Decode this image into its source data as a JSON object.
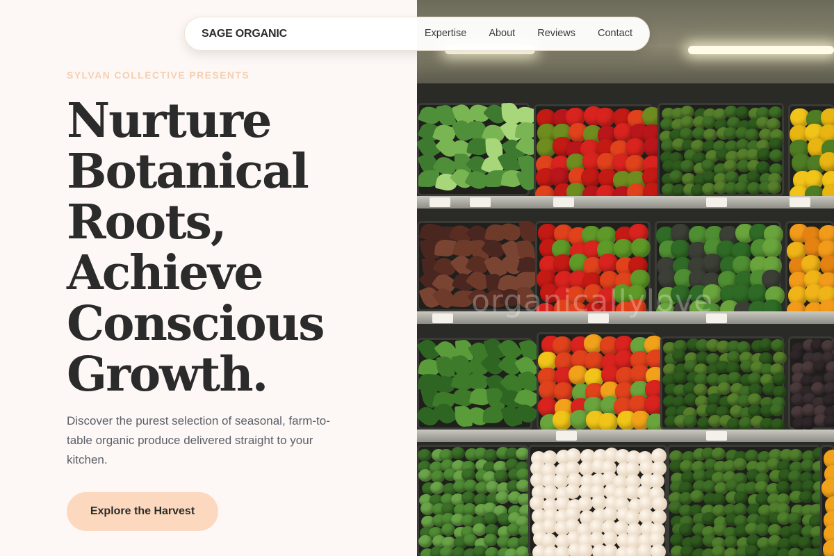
{
  "nav": {
    "brand": "SAGE ORGANIC",
    "links": [
      "Expertise",
      "About",
      "Reviews",
      "Contact"
    ]
  },
  "hero": {
    "eyebrow": "SYLVAN COLLECTIVE PRESENTS",
    "headline_lines": [
      "Nurture",
      "Botanical",
      "Roots,",
      "Achieve",
      "Conscious",
      "Growth."
    ],
    "description": "Discover the purest selection of seasonal, farm-to-table organic produce delivered straight to your kitchen.",
    "cta_label": "Explore the Harvest"
  },
  "image": {
    "watermark": "organicallylove"
  },
  "colors": {
    "background": "#fdf8f6",
    "accent": "#fcd9be",
    "eyebrow": "#f5cfb0",
    "text": "#2b2b2b"
  }
}
